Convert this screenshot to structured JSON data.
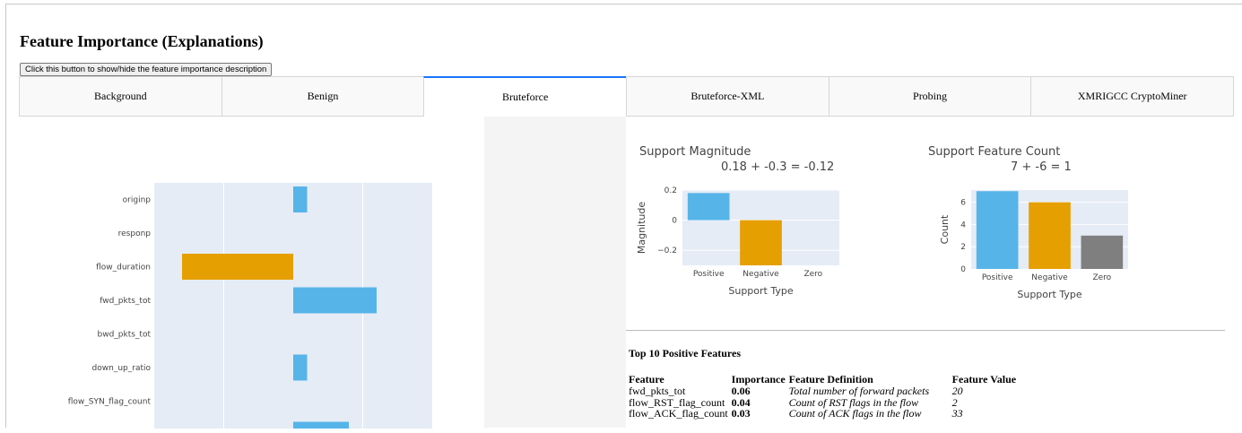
{
  "title": "Feature Importance (Explanations)",
  "toggle_button": "Click this button to show/hide the feature importance description",
  "tabs": [
    {
      "label": "Background",
      "active": false
    },
    {
      "label": "Benign",
      "active": false
    },
    {
      "label": "Bruteforce",
      "active": true
    },
    {
      "label": "Bruteforce-XML",
      "active": false
    },
    {
      "label": "Probing",
      "active": false
    },
    {
      "label": "XMRIGCC CryptoMiner",
      "active": false
    }
  ],
  "colors": {
    "positive": "#56b4e9",
    "negative": "#e69f00",
    "zero": "#7f7f7f",
    "plot_bg": "#e5ecf6",
    "tab_accent": "#1975fa"
  },
  "chart_data": [
    {
      "type": "bar",
      "orientation": "horizontal",
      "categories": [
        "originp",
        "responp",
        "flow_duration",
        "fwd_pkts_tot",
        "bwd_pkts_tot",
        "down_up_ratio",
        "flow_SYN_flag_count",
        ""
      ],
      "values": [
        0.01,
        0,
        -0.08,
        0.06,
        0,
        0.01,
        0,
        0.04
      ],
      "xlim": [
        -0.1,
        0.1
      ],
      "colors": [
        "positive",
        "positive",
        "negative",
        "positive",
        "positive",
        "positive",
        "positive",
        "positive"
      ]
    },
    {
      "type": "bar",
      "title": "Support Magnitude",
      "subtitle": "0.18 + -0.3 = -0.12",
      "xlabel": "Support Type",
      "ylabel": "Magnitude",
      "categories": [
        "Positive",
        "Negative",
        "Zero"
      ],
      "values": [
        0.18,
        -0.3,
        0
      ],
      "yticks": [
        0.2,
        0,
        -0.2
      ],
      "ytick_labels": [
        "0.2",
        "0",
        "−0.2"
      ],
      "ylim": [
        -0.3,
        0.2
      ]
    },
    {
      "type": "bar",
      "title": "Support Feature Count",
      "subtitle": "7 + -6 = 1",
      "xlabel": "Support Type",
      "ylabel": "Count",
      "categories": [
        "Positive",
        "Negative",
        "Zero"
      ],
      "values": [
        7,
        6,
        3
      ],
      "yticks": [
        0,
        2,
        4,
        6
      ],
      "ytick_labels": [
        "0",
        "2",
        "4",
        "6"
      ],
      "ylim": [
        0,
        7.1
      ]
    }
  ],
  "top_features": {
    "title": "Top 10 Positive Features",
    "headers": [
      "Feature",
      "Importance",
      "Feature Definition",
      "Feature Value"
    ],
    "rows": [
      [
        "fwd_pkts_tot",
        "0.06",
        "Total number of forward packets",
        "20"
      ],
      [
        "flow_RST_flag_count",
        "0.04",
        "Count of RST flags in the flow",
        "2"
      ],
      [
        "flow_ACK_flag_count",
        "0.03",
        "Count of ACK flags in the flow",
        "33"
      ]
    ]
  }
}
